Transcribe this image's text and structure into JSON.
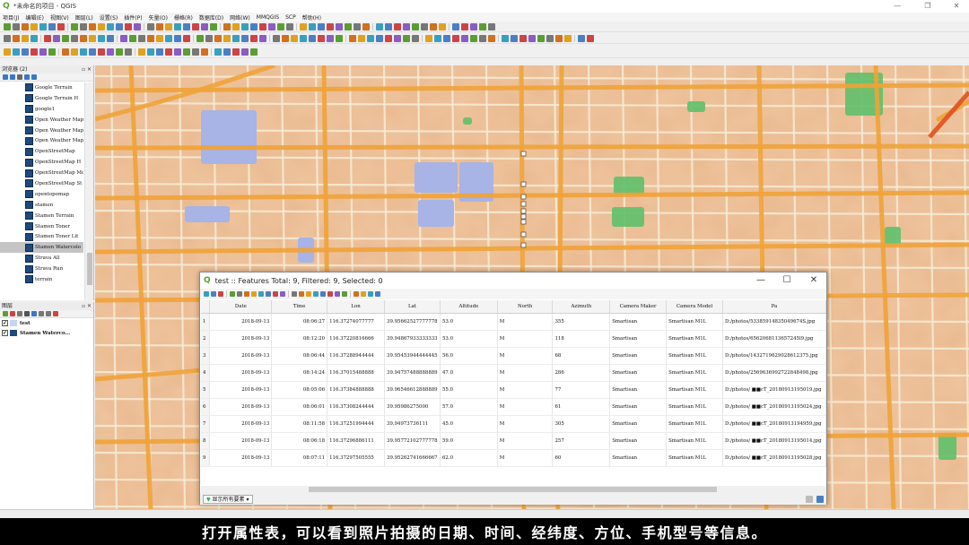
{
  "window": {
    "title": "*未命名的项目 - QGIS"
  },
  "menus": [
    "项目(J)",
    "编辑(E)",
    "视图(V)",
    "图层(L)",
    "设置(S)",
    "插件(P)",
    "矢量(O)",
    "栅格(R)",
    "数据库(D)",
    "网络(W)",
    "MMQGIS",
    "SCP",
    "帮助(H)"
  ],
  "browser": {
    "title": "浏览器 (2)",
    "items": [
      "Google Terrain",
      "Google Terrain H",
      "google1",
      "Open Weather Map",
      "Open Weather Map",
      "Open Weather Map",
      "OpenStreetMap",
      "OpenStreetMap H",
      "OpenStreetMap Mo",
      "OpenStreetMap St",
      "opentopomap",
      "stamen",
      "Stamen Terrain",
      "Stamen Toner",
      "Stamen Toner Lit",
      "Stamen Watercolo",
      "Strava All",
      "Strava Run",
      "terrain"
    ],
    "selected_index": 15
  },
  "layers": {
    "title": "图层",
    "items": [
      {
        "name": "test",
        "checked": true
      },
      {
        "name": "Stamen Waterco...",
        "checked": true
      }
    ]
  },
  "attribute_table": {
    "title": "test :: Features Total: 9, Filtered: 9, Selected: 0",
    "columns": [
      "",
      "Date",
      "Time",
      "Lon",
      "Lat",
      "Altitude",
      "North",
      "Azimuth",
      "Camera Maker",
      "Camera Model",
      "Pa"
    ],
    "rows": [
      [
        "1",
        "2018-09-13",
        "08:06:27",
        "116.37274077777",
        "39.95662527777778",
        "53.0",
        "M",
        "355",
        "Smartisan",
        "Smartisan M1L",
        "D:/photos/53385914835049674S.jpg"
      ],
      [
        "2",
        "2018-09-13",
        "08:12:20",
        "116.37220816666",
        "39.94867933333333",
        "53.0",
        "M",
        "118",
        "Smartisan",
        "Smartisan M1L",
        "D:/photos/6562068113657245l9.jpg"
      ],
      [
        "3",
        "2018-09-13",
        "08:06:44",
        "116.37288944444",
        "39.95453944444445",
        "56.0",
        "M",
        "68",
        "Smartisan",
        "Smartisan M1L",
        "D:/photos/1432719629028612375.jpg"
      ],
      [
        "4",
        "2018-09-13",
        "08:14:24",
        "116.37015488888",
        "39.94757488888889",
        "47.0",
        "M",
        "286",
        "Smartisan",
        "Smartisan M1L",
        "D:/photos/2569636992722848498.jpg"
      ],
      [
        "5",
        "2018-09-13",
        "08:05:06",
        "116.37384888888",
        "39.96546612888889",
        "55.0",
        "M",
        "77",
        "Smartisan",
        "Smartisan M1L",
        "D:/photos/ ■■cT_20180913195019.jpg"
      ],
      [
        "6",
        "2018-09-13",
        "08:06:01",
        "116.37308244444",
        "39.95986275000",
        "57.0",
        "M",
        "61",
        "Smartisan",
        "Smartisan M1L",
        "D:/photos/ ■■cT_20180913195024.jpg"
      ],
      [
        "7",
        "2018-09-13",
        "08:11:58",
        "116.37251994444",
        "39.94973736111",
        "45.0",
        "M",
        "305",
        "Smartisan",
        "Smartisan M1L",
        "D:/photos/ ■■cT_20180913194959.jpg"
      ],
      [
        "8",
        "2018-09-13",
        "08:06:18",
        "116.37296886111",
        "39.95772102777778",
        "59.0",
        "M",
        "257",
        "Smartisan",
        "Smartisan M1L",
        "D:/photos/ ■■cT_20180913195014.jpg"
      ],
      [
        "9",
        "2018-09-13",
        "08:07:11",
        "116.37297505555",
        "39.95262741666667",
        "62.0",
        "M",
        "60",
        "Smartisan",
        "Smartisan M1L",
        "D:/photos/ ■■cT_20180913195028.jpg"
      ]
    ],
    "show_all_label": "显示所有要素"
  },
  "subtitle": "打开属性表，可以看到照片拍摄的日期、时间、经纬度、方位、手机型号等信息。",
  "colors": {
    "map_base": "#e9b98f",
    "road": "#f0a338",
    "road_minor": "#f6ecd6",
    "water": "#a8b3e6",
    "park": "#5fc06a",
    "qgis_green": "#5a9e32"
  },
  "icons": [
    "qgis-logo-icon",
    "minimize-icon",
    "maximize-icon",
    "close-icon",
    "checkbox-icon",
    "filter-icon"
  ]
}
